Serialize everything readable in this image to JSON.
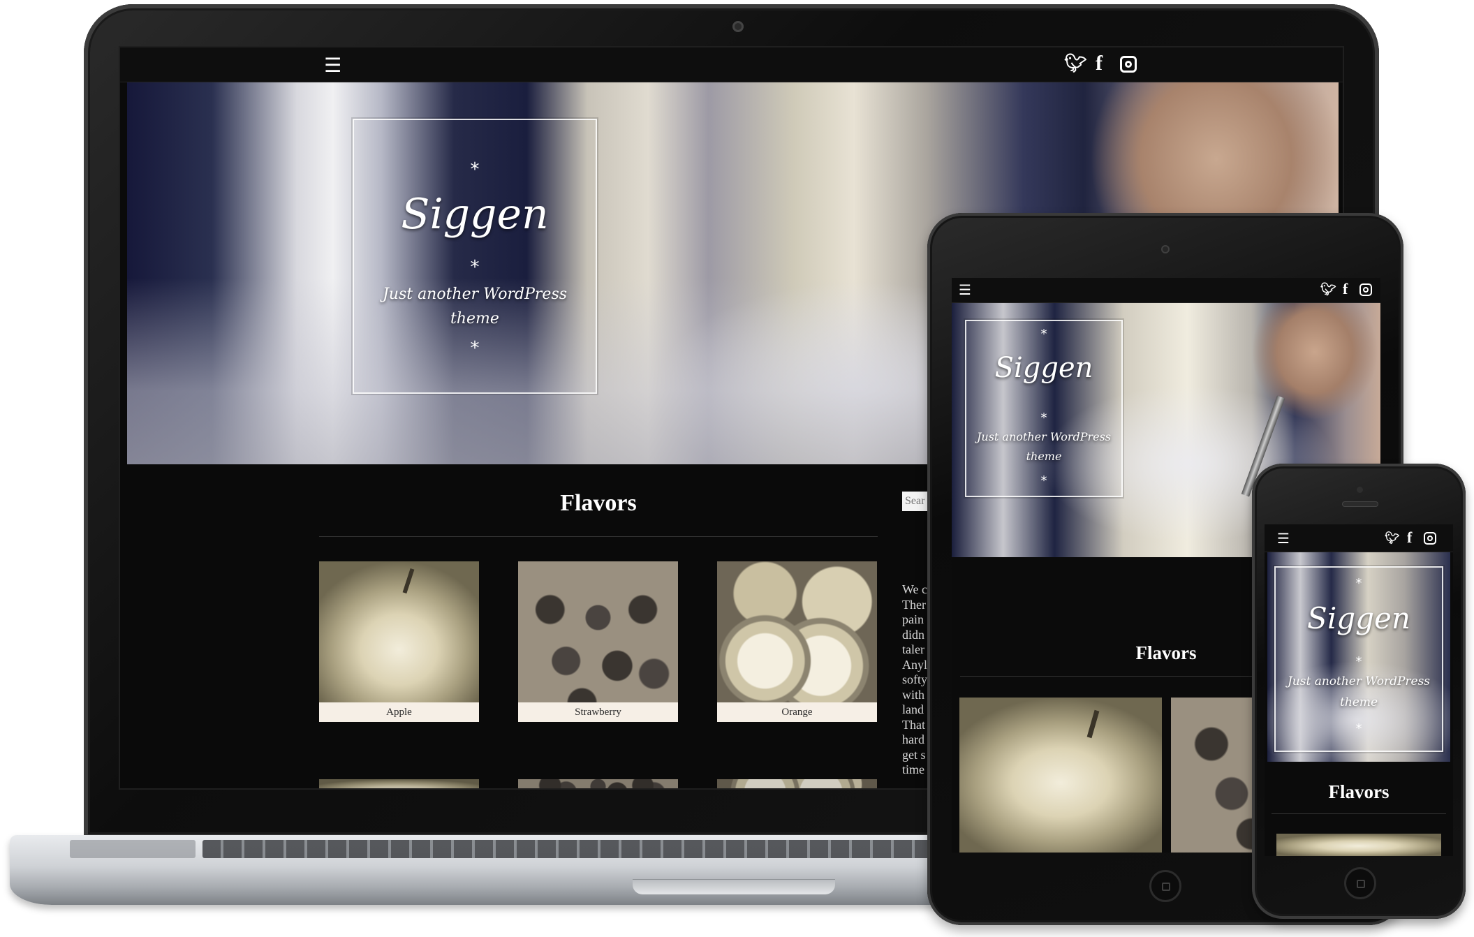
{
  "site": {
    "title": "Siggen",
    "tagline": "Just another WordPress theme",
    "star": "*"
  },
  "nav": {
    "menu_icon": "menu-icon",
    "social": [
      "twitter-icon",
      "facebook-icon",
      "instagram-icon"
    ]
  },
  "section": {
    "title": "Flavors"
  },
  "flavors": [
    {
      "name": "Apple"
    },
    {
      "name": "Strawberry"
    },
    {
      "name": "Orange"
    }
  ],
  "sidebar": {
    "search_placeholder": "Sear",
    "text_lines": [
      "We c",
      "Ther",
      "pain",
      "didn",
      "taler",
      "Anyl",
      "softy",
      "with",
      "land",
      "That",
      "hard",
      "get s",
      "time"
    ]
  },
  "colors": {
    "background": "#0a0a0a",
    "text": "#ffffff",
    "caption_bg": "#f6efe6"
  }
}
